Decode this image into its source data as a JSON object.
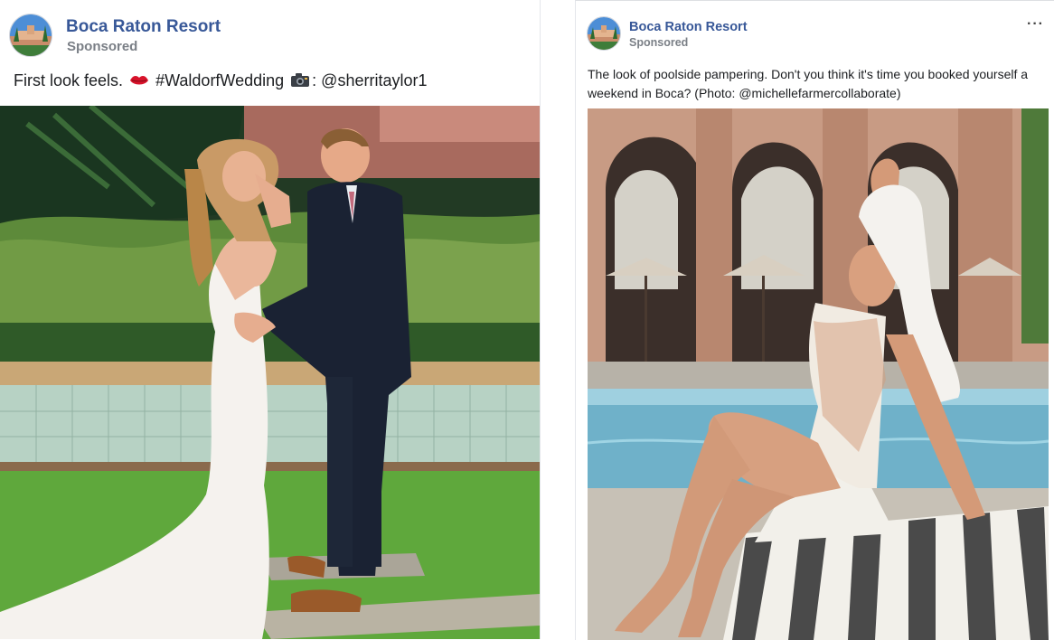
{
  "posts": [
    {
      "page_name": "Boca Raton Resort",
      "sponsored_label": "Sponsored",
      "caption": {
        "part1": "First look feels.",
        "hashtag": "#WaldorfWedding",
        "part2": ": @sherritaylor1"
      },
      "icons": [
        "avatar-image",
        "lips-emoji-icon",
        "camera-emoji-icon"
      ]
    },
    {
      "page_name": "Boca Raton Resort",
      "sponsored_label": "Sponsored",
      "more_label": "···",
      "caption": "The look of poolside pampering. Don't you think it's time you booked yourself a weekend in Boca? (Photo: @michellefarmercollaborate)",
      "icons": [
        "avatar-image",
        "more-options-icon"
      ]
    }
  ]
}
